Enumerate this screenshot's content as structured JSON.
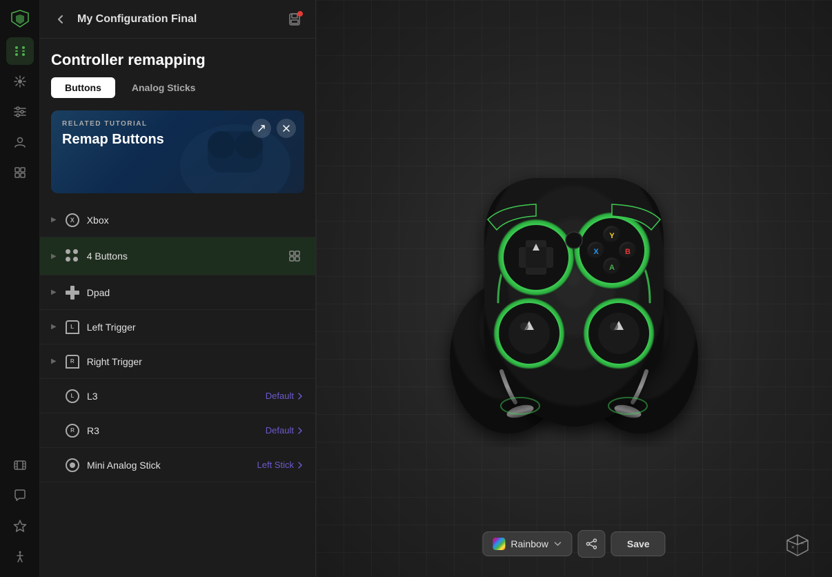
{
  "app": {
    "title": "My Configuration Final"
  },
  "sidebar": {
    "back_label": "←",
    "title": "My Configuration Final",
    "section_title": "Controller remapping",
    "tabs": [
      {
        "id": "buttons",
        "label": "Buttons",
        "active": true
      },
      {
        "id": "analog",
        "label": "Analog Sticks",
        "active": false
      }
    ],
    "tutorial": {
      "related_label": "RELATED TUTORIAL",
      "title": "Remap Buttons"
    },
    "list_items": [
      {
        "id": "xbox",
        "label": "Xbox",
        "icon_type": "xbox",
        "has_chevron": true,
        "value": "",
        "has_expand": false
      },
      {
        "id": "4buttons",
        "label": "4 Buttons",
        "icon_type": "4btn",
        "has_chevron": true,
        "value": "",
        "has_expand": true,
        "highlighted": true
      },
      {
        "id": "dpad",
        "label": "Dpad",
        "icon_type": "dpad",
        "has_chevron": true,
        "value": "",
        "has_expand": false
      },
      {
        "id": "left-trigger",
        "label": "Left Trigger",
        "icon_type": "lt",
        "has_chevron": true,
        "value": "",
        "has_expand": false
      },
      {
        "id": "right-trigger",
        "label": "Right Trigger",
        "icon_type": "rt",
        "has_chevron": true,
        "value": "",
        "has_expand": false
      },
      {
        "id": "l3",
        "label": "L3",
        "icon_type": "circle-l",
        "has_chevron": false,
        "value": "Default",
        "value_chevron": true
      },
      {
        "id": "r3",
        "label": "R3",
        "icon_type": "circle-r",
        "has_chevron": false,
        "value": "Default",
        "value_chevron": true
      },
      {
        "id": "mini-analog",
        "label": "Mini Analog Stick",
        "icon_type": "analog",
        "has_chevron": false,
        "value": "Left Stick",
        "value_chevron": true
      }
    ]
  },
  "bottom_bar": {
    "rainbow_label": "Rainbow",
    "save_label": "Save"
  },
  "icon_bar": {
    "items": [
      {
        "id": "logo",
        "icon": "razer"
      },
      {
        "id": "remapping",
        "icon": "gamepad",
        "active": true
      },
      {
        "id": "lighting",
        "icon": "sun"
      },
      {
        "id": "settings",
        "icon": "sliders"
      },
      {
        "id": "profiles",
        "icon": "user"
      },
      {
        "id": "macros",
        "icon": "layers"
      },
      {
        "id": "movies",
        "icon": "film"
      },
      {
        "id": "chat",
        "icon": "chat"
      },
      {
        "id": "favorites",
        "icon": "star"
      },
      {
        "id": "accessibility",
        "icon": "person"
      }
    ]
  }
}
